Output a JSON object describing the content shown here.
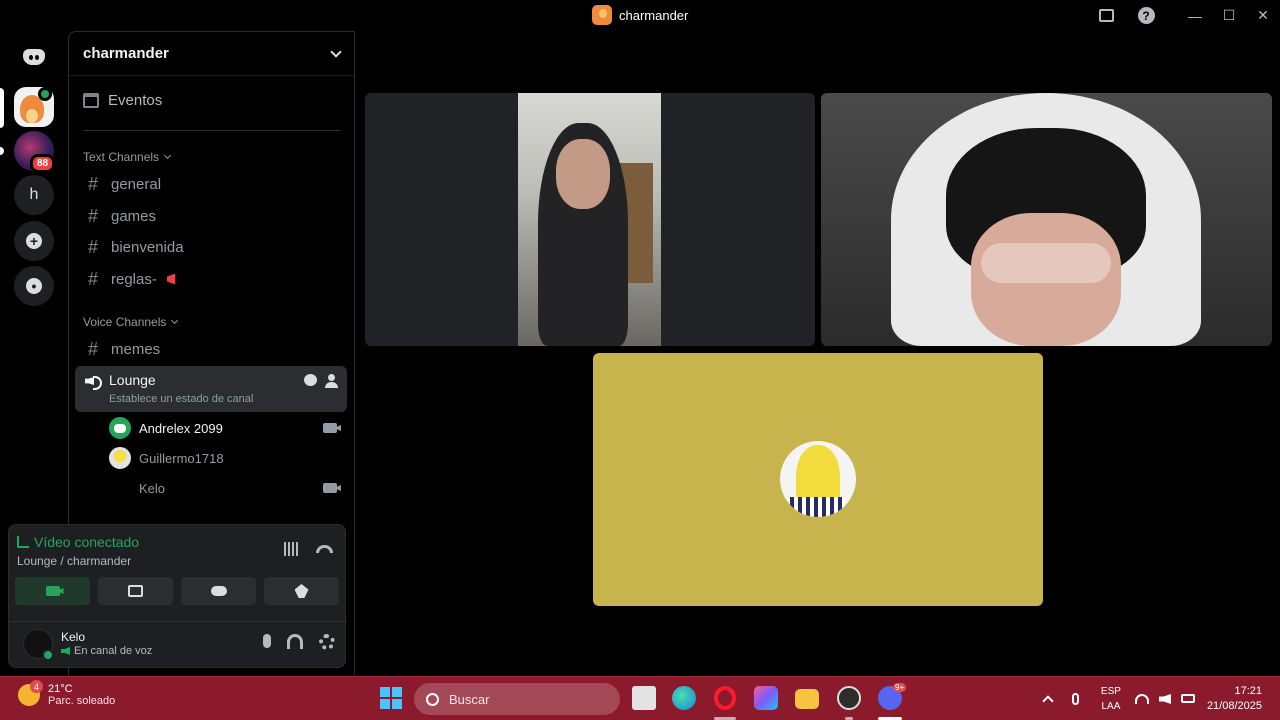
{
  "window": {
    "title": "charmander"
  },
  "guilds": {
    "mention_count": "88",
    "text_server_initial": "h"
  },
  "server": {
    "name": "charmander",
    "events_label": "Eventos"
  },
  "text_category": {
    "label": "Text Channels",
    "channels": [
      "general",
      "games",
      "bienvenida",
      "reglas-"
    ]
  },
  "voice_category": {
    "label": "Voice Channels",
    "channels": [
      "memes"
    ],
    "active_channel": {
      "name": "Lounge",
      "status_prompt": "Establece un estado de canal",
      "users": [
        {
          "name": "Andrelex 2099",
          "camera": true
        },
        {
          "name": "Guillermo1718",
          "camera": false
        },
        {
          "name": "Kelo",
          "camera": true
        }
      ]
    }
  },
  "voice_panel": {
    "status": "Vídeo conectado",
    "location": "Lounge / charmander"
  },
  "user": {
    "name": "Kelo",
    "status": "En canal de voz"
  },
  "taskbar": {
    "weather_badge": "4",
    "temperature": "21°C",
    "condition": "Parc. soleado",
    "search_placeholder": "Buscar",
    "discord_badge": "9+",
    "lang_top": "ESP",
    "lang_bottom": "LAA",
    "time": "17:21",
    "date": "21/08/2025"
  },
  "colors": {
    "online": "#23a55a",
    "mention": "#f23f43",
    "taskbar": "#8b1b2c",
    "tile_banana": "#c8b44c"
  }
}
